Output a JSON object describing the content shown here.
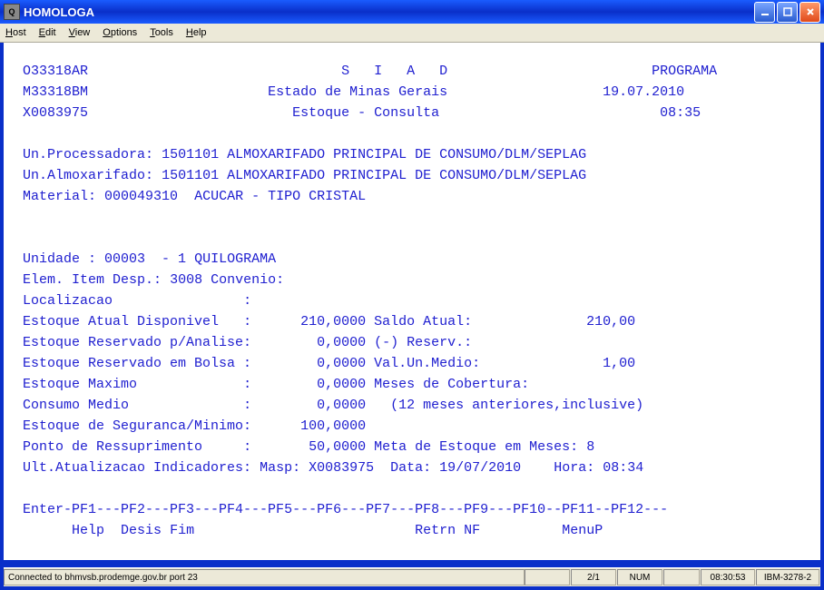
{
  "window": {
    "title": "HOMOLOGA",
    "icon_letter": "Q"
  },
  "menubar": {
    "host": "Host",
    "edit": "Edit",
    "view": "View",
    "options": "Options",
    "tools": "Tools",
    "help": "Help"
  },
  "header": {
    "code1": "O33318AR",
    "system": "S   I   A   D",
    "right1": "PROGRAMA",
    "code2": "M33318BM",
    "subtitle": "Estado de Minas Gerais",
    "date": "19.07.2010",
    "code3": "X0083975",
    "screen": "Estoque - Consulta",
    "time": "08:35"
  },
  "body": {
    "un_proc_label": "Un.Processadora:",
    "un_proc_value": "1501101 ALMOXARIFADO PRINCIPAL DE CONSUMO/DLM/SEPLAG",
    "un_almox_label": "Un.Almoxarifado:",
    "un_almox_value": "1501101 ALMOXARIFADO PRINCIPAL DE CONSUMO/DLM/SEPLAG",
    "material_label": "Material:",
    "material_code": "000049310",
    "material_desc": "ACUCAR - TIPO CRISTAL",
    "unidade_label": "Unidade :",
    "unidade_value": "00003  - 1 QUILOGRAMA",
    "elem_label": "Elem. Item Desp.:",
    "elem_value": "3008",
    "convenio_label": "Convenio:",
    "localizacao_label": "Localizacao",
    "estoque_disp_label": "Estoque Atual Disponivel",
    "estoque_disp_value": "210,0000",
    "saldo_atual_label": "Saldo Atual:",
    "saldo_atual_value": "210,00",
    "estoque_reserv_analise_label": "Estoque Reservado p/Analise:",
    "estoque_reserv_analise_value": "0,0000",
    "reserv_label": "(-) Reserv.:",
    "estoque_reserv_bolsa_label": "Estoque Reservado em Bolsa :",
    "estoque_reserv_bolsa_value": "0,0000",
    "val_un_medio_label": "Val.Un.Medio:",
    "val_un_medio_value": "1,00",
    "estoque_max_label": "Estoque Maximo",
    "estoque_max_value": "0,0000",
    "meses_cob_label": "Meses de Cobertura:",
    "consumo_medio_label": "Consumo Medio",
    "consumo_medio_value": "0,0000",
    "consumo_medio_note": "(12 meses anteriores,inclusive)",
    "estoque_seg_label": "Estoque de Seguranca/Minimo:",
    "estoque_seg_value": "100,0000",
    "ponto_ressup_label": "Ponto de Ressuprimento",
    "ponto_ressup_value": "50,0000",
    "meta_estoque_label": "Meta de Estoque em Meses:",
    "meta_estoque_value": "8",
    "ult_atual_label": "Ult.Atualizacao Indicadores:",
    "masp_label": "Masp:",
    "masp_value": "X0083975",
    "data_label": "Data:",
    "data_value": "19/07/2010",
    "hora_label": "Hora:",
    "hora_value": "08:34"
  },
  "fkeys": {
    "line1": "Enter-PF1---PF2---PF3---PF4---PF5---PF6---PF7---PF8---PF9---PF10--PF11--PF12---",
    "help": "Help",
    "desis": "Desis",
    "fim": "Fim",
    "retrn": "Retrn",
    "nf": "NF",
    "menup": "MenuP"
  },
  "statusbar": {
    "connected": "Connected to bhmvsb.prodemge.gov.br port 23",
    "cursor": "2/1",
    "num": "NUM",
    "clock": "08:30:53",
    "term": "IBM-3278-2"
  }
}
